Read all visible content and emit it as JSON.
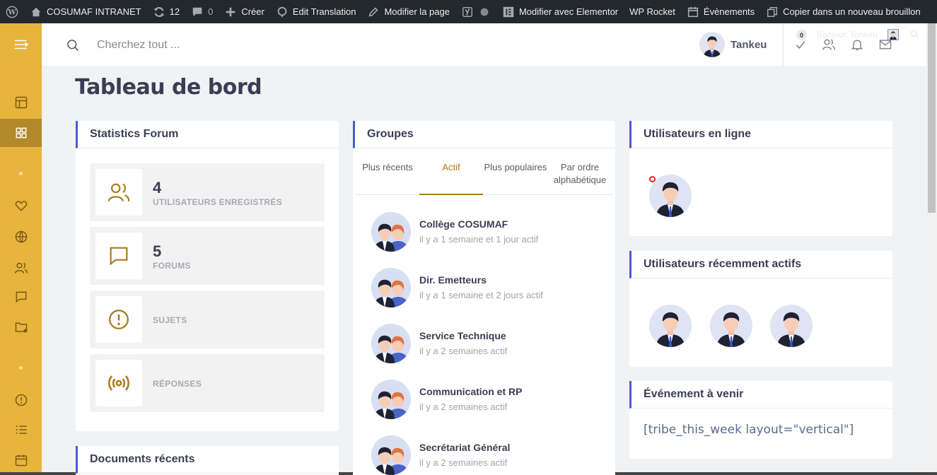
{
  "adminbar": {
    "site_name": "COSUMAF INTRANET",
    "updates_count": "12",
    "comments_count": "0",
    "create_label": "Créer",
    "edit_translation_label": "Edit Translation",
    "edit_page_label": "Modifier la page",
    "elementor_label": "Modifier avec Elementor",
    "wp_rocket_label": "WP Rocket",
    "events_label": "Évènements",
    "copy_draft_label": "Copier dans un nouveau brouillon"
  },
  "header": {
    "search_placeholder": "Cherchez tout ...",
    "user_name": "Tankeu",
    "notification_badge": "0",
    "greeting": "Bonjour, Tankeu"
  },
  "page": {
    "title": "Tableau de bord"
  },
  "stats_card": {
    "title": "Statistics Forum",
    "items": [
      {
        "icon": "users-icon",
        "number": "4",
        "label": "UTILISATEURS ENREGISTRÉS"
      },
      {
        "icon": "message-icon",
        "number": "5",
        "label": "FORUMS"
      },
      {
        "icon": "alert-circle-icon",
        "number": "",
        "label": "SUJETS"
      },
      {
        "icon": "broadcast-icon",
        "number": "",
        "label": "RÉPONSES"
      }
    ]
  },
  "documents_card": {
    "title": "Documents récents"
  },
  "groups_card": {
    "title": "Groupes",
    "tabs": [
      "Plus récents",
      "Actif",
      "Plus populaires",
      "Par ordre alphabétique"
    ],
    "active_tab": "Actif",
    "items": [
      {
        "name": "Collège COSUMAF",
        "time": "il y a 1 semaine et 1 jour actif"
      },
      {
        "name": "Dir. Emetteurs",
        "time": "il y a 1 semaine et 2 jours actif"
      },
      {
        "name": "Service Technique",
        "time": "il y a 2 semaines actif"
      },
      {
        "name": "Communication et RP",
        "time": "il y a 2 semaines actif"
      },
      {
        "name": "Secrétariat Général",
        "time": "il y a 2 semaines actif"
      }
    ]
  },
  "online_card": {
    "title": "Utilisateurs en ligne"
  },
  "recent_card": {
    "title": "Utilisateurs récemment actifs"
  },
  "events_card": {
    "title": "Événement à venir",
    "shortcode": "[tribe_this_week layout=\"vertical\"]"
  },
  "colors": {
    "sidebar": "#e7b43c",
    "sidebar_active": "#b3892c",
    "accent_blue": "#4a5bd0",
    "accent_gold": "#b07a10"
  }
}
